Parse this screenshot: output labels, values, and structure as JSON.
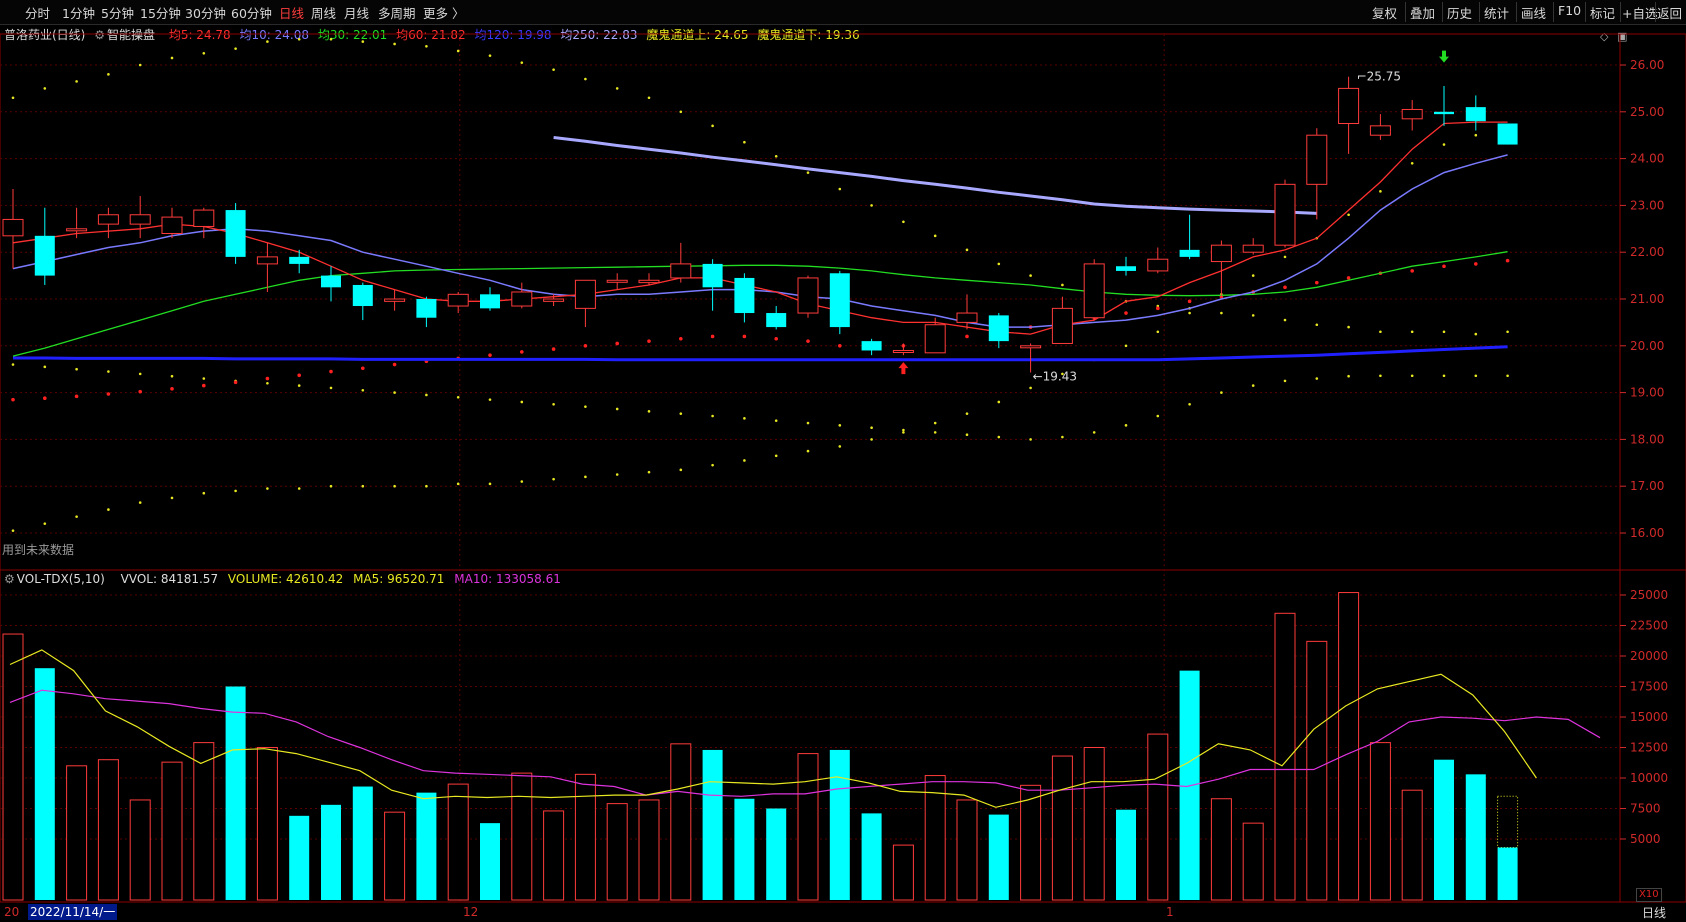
{
  "toolbar": {
    "periods": [
      "分时",
      "1分钟",
      "5分钟",
      "15分钟",
      "30分钟",
      "60分钟",
      "日线",
      "周线",
      "月线",
      "多周期",
      "更多 〉"
    ],
    "active_period": "日线",
    "right_buttons": [
      "复权",
      "叠加",
      "历史",
      "统计",
      "画线",
      "F10",
      "标记",
      "+自选",
      "返回"
    ]
  },
  "header": {
    "stock": "普洛药业(日线)",
    "indicator": "智能操盘",
    "ma5": "均5: 24.78",
    "ma10": "均10: 24.08",
    "ma30": "均30: 22.01",
    "ma60": "均60: 21.82",
    "ma120": "均120: 19.98",
    "ma250": "均250: 22.83",
    "ch_up": "魔鬼通道上: 24.65",
    "ch_dn": "魔鬼通道下: 19.36",
    "future_note": "用到未来数据"
  },
  "volume_header": {
    "name": "VOL-TDX(5,10)",
    "vvol": "VVOL: 84181.57",
    "volume": "VOLUME: 42610.42",
    "ma5": "MA5: 96520.71",
    "ma10": "MA10: 133058.61"
  },
  "colors": {
    "up": "#ff3b3b",
    "down": "#00ffff",
    "ma5": "#ff3030",
    "ma10": "#7a7aff",
    "ma30": "#22dd22",
    "ma120": "#2020ff",
    "ma250": "#a8a8ff",
    "vol_ma5": "#e8e822",
    "vol_ma10": "#dd33dd"
  },
  "bottom": {
    "date_cursor": "2022/11/14/一",
    "x_labels": [
      "20",
      "12",
      "1"
    ],
    "x10": "X10",
    "period_tab": "日线"
  },
  "chart_data": [
    {
      "type": "candlestick",
      "title": "普洛药业(日线)",
      "ylim": [
        15.7,
        26.4
      ],
      "yticks": [
        "26.00",
        "25.00",
        "24.00",
        "23.00",
        "22.00",
        "21.00",
        "20.00",
        "19.00",
        "18.00",
        "17.00",
        "16.00"
      ],
      "annotations": {
        "high": "25.75",
        "low": "19.43"
      },
      "candles": [
        [
          22.35,
          22.7,
          23.35,
          21.65
        ],
        [
          22.35,
          21.5,
          22.95,
          21.3
        ],
        [
          22.5,
          22.5,
          22.95,
          22.3
        ],
        [
          22.6,
          22.8,
          22.95,
          22.3
        ],
        [
          22.6,
          22.8,
          23.2,
          22.3
        ],
        [
          22.4,
          22.75,
          22.95,
          22.3
        ],
        [
          22.55,
          22.9,
          22.95,
          22.3
        ],
        [
          22.9,
          21.9,
          23.05,
          21.75
        ],
        [
          21.75,
          21.9,
          22.2,
          21.15
        ],
        [
          21.9,
          21.75,
          22.05,
          21.55
        ],
        [
          21.5,
          21.25,
          21.7,
          20.95
        ],
        [
          21.3,
          20.85,
          21.35,
          20.55
        ],
        [
          20.95,
          21.0,
          21.2,
          20.75
        ],
        [
          21.0,
          20.6,
          21.05,
          20.4
        ],
        [
          20.85,
          21.1,
          21.15,
          20.7
        ],
        [
          21.1,
          20.8,
          21.25,
          20.75
        ],
        [
          20.85,
          21.15,
          21.35,
          20.8
        ],
        [
          20.95,
          21.0,
          21.1,
          20.85
        ],
        [
          20.8,
          21.4,
          21.4,
          20.4
        ],
        [
          21.4,
          21.4,
          21.55,
          21.2
        ],
        [
          21.35,
          21.4,
          21.55,
          21.3
        ],
        [
          21.45,
          21.75,
          22.2,
          21.35
        ],
        [
          21.75,
          21.25,
          21.85,
          20.75
        ],
        [
          21.45,
          20.7,
          21.55,
          20.5
        ],
        [
          20.7,
          20.4,
          20.85,
          20.35
        ],
        [
          20.7,
          21.45,
          21.5,
          20.6
        ],
        [
          21.55,
          20.4,
          21.6,
          20.25
        ],
        [
          20.1,
          19.9,
          20.15,
          19.8
        ],
        [
          19.9,
          19.9,
          20.05,
          19.8
        ],
        [
          19.85,
          20.45,
          20.6,
          19.85
        ],
        [
          20.5,
          20.7,
          21.1,
          20.35
        ],
        [
          20.65,
          20.1,
          20.7,
          19.95
        ],
        [
          20.0,
          20.0,
          20.05,
          19.43
        ],
        [
          20.05,
          20.8,
          21.05,
          20.05
        ],
        [
          20.6,
          21.75,
          21.85,
          20.55
        ],
        [
          21.7,
          21.6,
          21.9,
          21.5
        ],
        [
          21.6,
          21.85,
          22.1,
          21.55
        ],
        [
          22.05,
          21.9,
          22.8,
          21.85
        ],
        [
          21.8,
          22.15,
          22.25,
          21.05
        ],
        [
          22.0,
          22.15,
          22.3,
          21.95
        ],
        [
          22.15,
          23.45,
          23.55,
          22.1
        ],
        [
          23.45,
          24.5,
          24.65,
          22.7
        ],
        [
          24.75,
          25.5,
          25.75,
          24.1
        ],
        [
          24.5,
          24.7,
          24.95,
          24.4
        ],
        [
          24.85,
          25.05,
          25.25,
          24.6
        ],
        [
          25.0,
          24.95,
          25.55,
          24.7
        ],
        [
          25.1,
          24.8,
          25.35,
          24.6
        ],
        [
          24.75,
          24.3,
          24.75,
          24.3
        ]
      ],
      "ma5": [
        22.2,
        22.3,
        22.4,
        22.45,
        22.5,
        22.6,
        22.55,
        22.4,
        22.2,
        22.0,
        21.7,
        21.4,
        21.2,
        21.0,
        20.95,
        20.95,
        21.0,
        21.05,
        21.1,
        21.2,
        21.3,
        21.45,
        21.45,
        21.3,
        21.15,
        20.9,
        20.75,
        20.6,
        20.5,
        20.5,
        20.4,
        20.3,
        20.25,
        20.45,
        20.55,
        20.95,
        21.05,
        21.35,
        21.6,
        21.9,
        22.05,
        22.3,
        22.9,
        23.5,
        24.2,
        24.75,
        24.78,
        24.78
      ],
      "ma10": [
        21.65,
        21.8,
        21.95,
        22.1,
        22.2,
        22.35,
        22.45,
        22.5,
        22.45,
        22.35,
        22.25,
        22.0,
        21.85,
        21.7,
        21.55,
        21.4,
        21.2,
        21.1,
        21.05,
        21.1,
        21.1,
        21.15,
        21.2,
        21.2,
        21.15,
        21.05,
        21.0,
        20.85,
        20.75,
        20.65,
        20.5,
        20.4,
        20.4,
        20.45,
        20.5,
        20.55,
        20.65,
        20.8,
        21.0,
        21.15,
        21.4,
        21.75,
        22.3,
        22.9,
        23.35,
        23.7,
        23.9,
        24.08
      ],
      "ma30": [
        19.78,
        19.95,
        20.15,
        20.35,
        20.55,
        20.75,
        20.95,
        21.1,
        21.25,
        21.4,
        21.5,
        21.55,
        21.6,
        21.62,
        21.63,
        21.64,
        21.65,
        21.66,
        21.67,
        21.68,
        21.69,
        21.7,
        21.71,
        21.72,
        21.72,
        21.7,
        21.66,
        21.6,
        21.52,
        21.45,
        21.4,
        21.35,
        21.3,
        21.22,
        21.15,
        21.1,
        21.08,
        21.07,
        21.08,
        21.1,
        21.15,
        21.25,
        21.4,
        21.55,
        21.7,
        21.8,
        21.9,
        22.01
      ],
      "ma120": [
        19.74,
        19.74,
        19.73,
        19.73,
        19.73,
        19.73,
        19.73,
        19.72,
        19.72,
        19.72,
        19.72,
        19.71,
        19.71,
        19.71,
        19.71,
        19.71,
        19.71,
        19.71,
        19.71,
        19.7,
        19.7,
        19.7,
        19.7,
        19.7,
        19.7,
        19.7,
        19.7,
        19.7,
        19.7,
        19.7,
        19.7,
        19.7,
        19.7,
        19.7,
        19.7,
        19.7,
        19.7,
        19.72,
        19.74,
        19.76,
        19.78,
        19.8,
        19.83,
        19.86,
        19.89,
        19.92,
        19.95,
        19.98
      ],
      "ma250": [
        24.45,
        24.37,
        24.28,
        24.2,
        24.12,
        24.03,
        23.95,
        23.87,
        23.78,
        23.7,
        23.62,
        23.53,
        23.45,
        23.37,
        23.28,
        23.2,
        23.12,
        23.03,
        22.98,
        22.95,
        22.92,
        22.9,
        22.88,
        22.86,
        22.83
      ],
      "ch_up": [
        25.3,
        25.5,
        25.65,
        25.8,
        26.0,
        26.15,
        26.25,
        26.35,
        26.5,
        26.55,
        26.55,
        26.5,
        26.45,
        26.4,
        26.3,
        26.2,
        26.05,
        25.9,
        25.7,
        25.5,
        25.3,
        25.0,
        24.7,
        24.35,
        24.05,
        23.7,
        23.35,
        23.0,
        22.65,
        22.35,
        22.05,
        21.75,
        21.5,
        21.3,
        21.1,
        20.95,
        20.85,
        20.8,
        20.7,
        20.65,
        20.55,
        20.45,
        20.4,
        20.3,
        20.3,
        20.3,
        20.25,
        20.3
      ],
      "ch_dn": [
        16.05,
        16.2,
        16.35,
        16.5,
        16.65,
        16.75,
        16.85,
        16.9,
        16.95,
        16.95,
        17.0,
        17.0,
        17.0,
        17.0,
        17.05,
        17.05,
        17.1,
        17.15,
        17.2,
        17.25,
        17.3,
        17.35,
        17.45,
        17.55,
        17.65,
        17.75,
        17.85,
        18.0,
        18.15,
        18.35,
        18.55,
        18.8,
        19.1,
        19.4,
        19.7,
        20.0,
        20.3,
        20.7,
        21.1,
        21.5,
        21.9,
        22.3,
        22.8,
        23.3,
        23.9,
        24.3,
        24.5,
        24.65
      ],
      "red_dots": [
        18.85,
        18.88,
        18.92,
        18.97,
        19.02,
        19.08,
        19.15,
        19.22,
        19.3,
        19.37,
        19.45,
        19.52,
        19.6,
        19.67,
        19.73,
        19.8,
        19.87,
        19.93,
        20.0,
        20.05,
        20.1,
        20.15,
        20.2,
        20.2,
        20.15,
        20.1,
        20.0,
        19.95,
        20.0,
        20.1,
        20.2,
        20.3,
        20.4,
        20.5,
        20.6,
        20.7,
        20.8,
        20.95,
        21.05,
        21.15,
        21.25,
        21.35,
        21.45,
        21.55,
        21.6,
        21.7,
        21.75,
        21.82
      ],
      "yellow_lower": [
        19.6,
        19.55,
        19.5,
        19.45,
        19.4,
        19.35,
        19.3,
        19.25,
        19.2,
        19.15,
        19.1,
        19.05,
        19.0,
        18.95,
        18.9,
        18.85,
        18.8,
        18.75,
        18.7,
        18.65,
        18.6,
        18.55,
        18.5,
        18.45,
        18.4,
        18.35,
        18.3,
        18.25,
        18.2,
        18.15,
        18.1,
        18.05,
        18.0,
        18.05,
        18.15,
        18.3,
        18.5,
        18.75,
        19.0,
        19.15,
        19.25,
        19.3,
        19.35,
        19.36,
        19.36,
        19.36,
        19.36,
        19.36
      ]
    },
    {
      "type": "bar",
      "title": "VOL-TDX(5,10)",
      "ylim": [
        0,
        26500
      ],
      "yticks": [
        "25000",
        "22500",
        "20000",
        "17500",
        "15000",
        "12500",
        "10000",
        "7500",
        "5000"
      ],
      "volumes": [
        21800,
        19000,
        11000,
        11500,
        8200,
        11300,
        12900,
        17500,
        12500,
        6900,
        7800,
        9300,
        7200,
        8800,
        9500,
        6300,
        10400,
        7300,
        10300,
        7900,
        8200,
        12800,
        12300,
        8300,
        7500,
        12000,
        12300,
        7100,
        4500,
        10200,
        8200,
        7000,
        9400,
        11800,
        12500,
        7400,
        13600,
        18800,
        8300,
        6300,
        23500,
        21200,
        25200,
        12900,
        9000,
        11500,
        10300,
        4300
      ],
      "vol_ma5": [
        19300,
        20500,
        18800,
        15500,
        14200,
        12600,
        11200,
        12300,
        12400,
        12000,
        11300,
        10600,
        9000,
        8300,
        8500,
        8400,
        8500,
        8400,
        8500,
        8600,
        8600,
        9100,
        9700,
        9600,
        9500,
        9700,
        10100,
        9600,
        8900,
        8800,
        8600,
        7600,
        8200,
        9000,
        9700,
        9700,
        9900,
        11200,
        12800,
        12300,
        11000,
        14000,
        15900,
        17300,
        17900,
        18500,
        16800,
        13800,
        10000
      ],
      "vol_ma10": [
        16200,
        17200,
        16900,
        16500,
        16300,
        16100,
        15700,
        15400,
        15300,
        14600,
        13400,
        12500,
        11500,
        10600,
        10400,
        10300,
        10200,
        10100,
        9500,
        9300,
        8600,
        8900,
        8600,
        8500,
        8700,
        8700,
        9100,
        9300,
        9500,
        9700,
        9700,
        9600,
        9000,
        9000,
        9200,
        9400,
        9500,
        9300,
        9900,
        10700,
        10700,
        10700,
        11900,
        13000,
        14600,
        15000,
        14900,
        14700,
        15000,
        14800,
        13300
      ]
    }
  ]
}
